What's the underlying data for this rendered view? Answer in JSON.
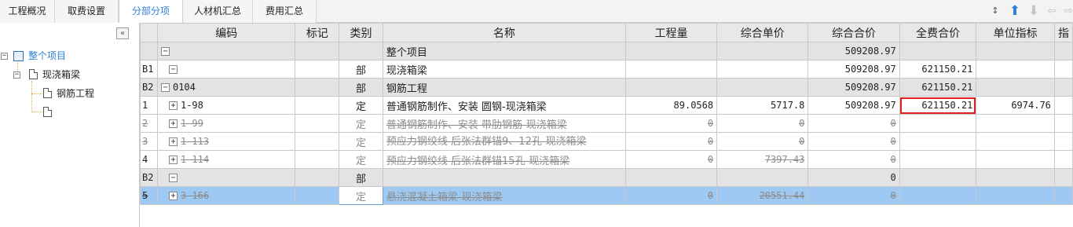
{
  "tabs": [
    {
      "label": "工程概况"
    },
    {
      "label": "取费设置"
    },
    {
      "label": "分部分项"
    },
    {
      "label": "人材机汇总"
    },
    {
      "label": "费用汇总"
    }
  ],
  "active_tab": "分部分项",
  "toolbar_icons": [
    "sort-icon",
    "move-up-icon",
    "move-down-icon",
    "indent-left-icon",
    "indent-right-icon"
  ],
  "tree": {
    "collapse_glyph": "«",
    "nodes": [
      {
        "label": "整个项目",
        "toggle": "−"
      },
      {
        "label": "现浇箱梁",
        "toggle": "−"
      },
      {
        "label": "钢筋工程"
      },
      {
        "label": ""
      }
    ]
  },
  "grid": {
    "columns": [
      "编码",
      "标记",
      "类别",
      "名称",
      "工程量",
      "综合单价",
      "综合合价",
      "全费合价",
      "单位指标",
      "指"
    ],
    "rows": [
      {
        "rn": "",
        "toggle": "−",
        "code": "",
        "mark": "",
        "type": "",
        "name": "整个项目",
        "qty": "",
        "unit_price": "",
        "total": "509208.97",
        "full_total": "",
        "unit_index": ""
      },
      {
        "rn": "B1",
        "toggle": "−",
        "code": "",
        "mark": "",
        "type": "部",
        "name": "现浇箱梁",
        "qty": "",
        "unit_price": "",
        "total": "509208.97",
        "full_total": "621150.21",
        "unit_index": ""
      },
      {
        "rn": "B2",
        "toggle": "−",
        "code": "0104",
        "mark": "",
        "type": "部",
        "name": "钢筋工程",
        "qty": "",
        "unit_price": "",
        "total": "509208.97",
        "full_total": "621150.21",
        "unit_index": ""
      },
      {
        "rn": "1",
        "toggle": "+",
        "code": "1-98",
        "mark": "",
        "type": "定",
        "name": "普通钢筋制作、安装 圆钢-现浇箱梁",
        "qty": "89.0568",
        "unit_price": "5717.8",
        "total": "509208.97",
        "full_total": "621150.21",
        "unit_index": "6974.76"
      },
      {
        "rn": "2",
        "toggle": "+",
        "code": "1-99",
        "mark": "",
        "type": "定",
        "name": "普通钢筋制作、安装 带肋钢筋-现浇箱梁",
        "qty": "0",
        "unit_price": "0",
        "total": "0",
        "full_total": "",
        "unit_index": ""
      },
      {
        "rn": "3",
        "toggle": "+",
        "code": "1-113",
        "mark": "",
        "type": "定",
        "name": "预应力钢绞线 后张法群锚9、12孔-现浇箱梁",
        "qty": "0",
        "unit_price": "0",
        "total": "0",
        "full_total": "",
        "unit_index": ""
      },
      {
        "rn": "4",
        "toggle": "+",
        "code": "1-114",
        "mark": "",
        "type": "定",
        "name": "预应力钢绞线 后张法群锚15孔-现浇箱梁",
        "qty": "0",
        "unit_price": "7397.43",
        "total": "0",
        "full_total": "",
        "unit_index": ""
      },
      {
        "rn": "B2",
        "toggle": "−",
        "code": "",
        "mark": "",
        "type": "部",
        "name": "",
        "qty": "",
        "unit_price": "",
        "total": "0",
        "full_total": "",
        "unit_index": ""
      },
      {
        "rn": "5",
        "toggle": "+",
        "code": "3-166",
        "mark": "",
        "type": "定",
        "name": "悬浇混凝土箱梁-现浇箱梁",
        "qty": "0",
        "unit_price": "20551.44",
        "total": "0",
        "full_total": "",
        "unit_index": ""
      }
    ]
  },
  "colors": {
    "accent": "#2f7fd6",
    "highlight_header": "#ffe9a6",
    "selected_row": "#9ec9f2",
    "callout": "#e02020"
  }
}
